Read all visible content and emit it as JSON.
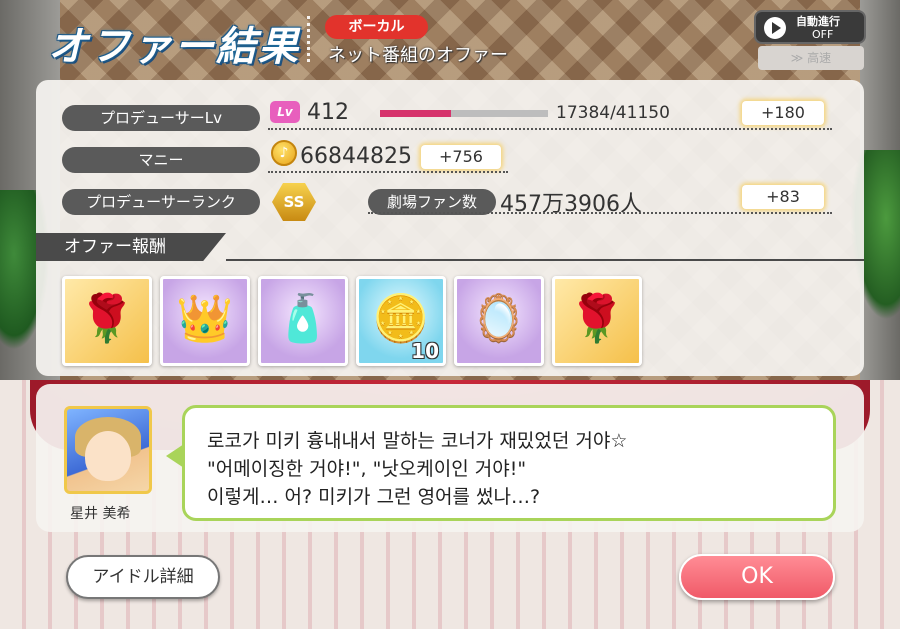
{
  "header": {
    "title": "オファー結果",
    "category": "ボーカル",
    "subtitle": "ネット番組のオファー"
  },
  "auto_progress": {
    "label": "自動進行",
    "state": "OFF",
    "speed_label": "≫ 高速"
  },
  "stats": {
    "producer_lv": {
      "label": "プロデューサーLv",
      "icon_text": "Lv",
      "value": "412",
      "xp_text": "17384/41150",
      "xp_fraction": 0.42,
      "gain": "+180"
    },
    "money": {
      "label": "マニー",
      "value": "66844825",
      "gain": "+756"
    },
    "producer_rank": {
      "label": "プロデューサーランク",
      "rank_text": "SS"
    },
    "fans": {
      "label": "劇場ファン数",
      "value": "457万3906人",
      "gain": "+83"
    }
  },
  "rewards": {
    "header": "オファー報酬",
    "items": [
      {
        "name": "rose",
        "glyph": "🌹",
        "bg": "gold",
        "count": ""
      },
      {
        "name": "crown",
        "glyph": "👑",
        "bg": "purple",
        "count": ""
      },
      {
        "name": "perfume",
        "glyph": "🧴",
        "bg": "purple",
        "count": ""
      },
      {
        "name": "coins",
        "glyph": "🪙",
        "bg": "blue",
        "count": "10"
      },
      {
        "name": "hand-mirror",
        "glyph": "🪞",
        "bg": "purple",
        "count": ""
      },
      {
        "name": "rose",
        "glyph": "🌹",
        "bg": "gold",
        "count": ""
      }
    ]
  },
  "dialogue": {
    "character_name": "星井 美希",
    "lines": [
      "로코가 미키 흉내내서 말하는 코너가 재밌었던 거야☆",
      "\"어메이징한 거야!\", \"낫오케이인 거야!\"",
      "이렇게… 어? 미키가 그런 영어를 썼나…?"
    ]
  },
  "buttons": {
    "idol_detail": "アイドル詳細",
    "ok": "OK"
  },
  "colors": {
    "accent_pink": "#d6336c",
    "ok_button": "#f05a68",
    "bubble_border": "#a9d45a",
    "category_red": "#e2332c"
  }
}
